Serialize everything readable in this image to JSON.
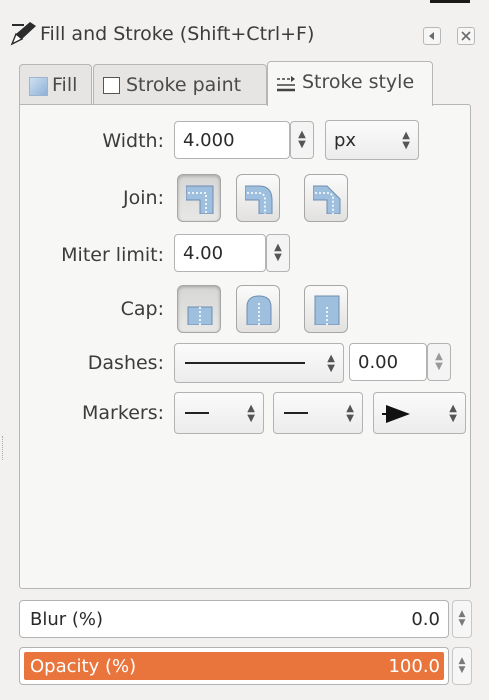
{
  "dialog": {
    "title": "Fill and Stroke (Shift+Ctrl+F)",
    "title_icon": "pen-icon",
    "buttons": [
      {
        "name": "iconify-button",
        "icon": "triangle-left-icon"
      },
      {
        "name": "close-button",
        "icon": "close-icon"
      }
    ]
  },
  "tabs": [
    {
      "label": "Fill",
      "icon": "flat-color-icon",
      "active": false
    },
    {
      "label": "Stroke paint",
      "icon": "empty-square-icon",
      "active": false
    },
    {
      "label": "Stroke style",
      "icon": "stroke-style-icon",
      "active": true
    }
  ],
  "stroke_style": {
    "width": {
      "label": "Width:",
      "value": "4.000",
      "unit": "px"
    },
    "join": {
      "label": "Join:",
      "options": [
        "miter-join",
        "round-join",
        "bevel-join"
      ],
      "selected": "miter-join"
    },
    "miter_limit": {
      "label": "Miter limit:",
      "value": "4.00"
    },
    "cap": {
      "label": "Cap:",
      "options": [
        "butt-cap",
        "round-cap",
        "square-cap"
      ],
      "selected": "butt-cap"
    },
    "dashes": {
      "label": "Dashes:",
      "pattern": "solid-line",
      "offset": "0.00"
    },
    "markers": {
      "label": "Markers:",
      "start": "line-marker",
      "mid": "line-marker",
      "end": "arrow-marker"
    }
  },
  "blur": {
    "label": "Blur (%)",
    "value": "0.0"
  },
  "opacity": {
    "label": "Opacity (%)",
    "value": "100.0",
    "level": 1.0
  },
  "colors": {
    "accent": "#e9753c",
    "toggle_fill": "#9fbfde"
  }
}
